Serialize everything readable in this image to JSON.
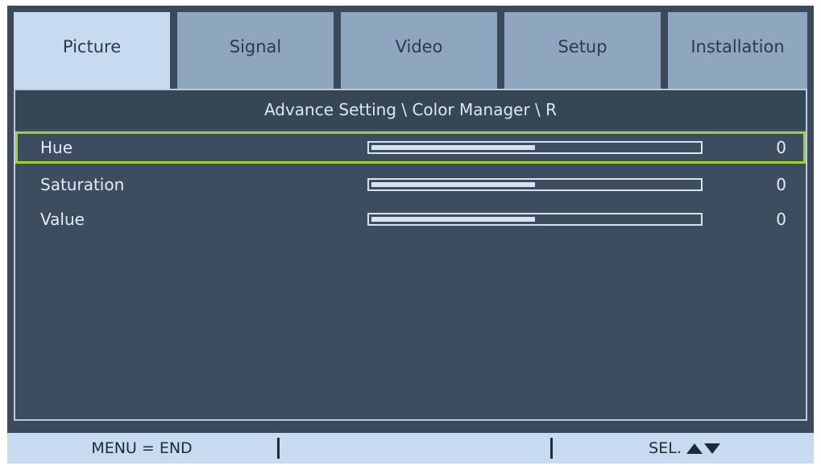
{
  "tabs": [
    {
      "label": "Picture",
      "active": true
    },
    {
      "label": "Signal",
      "active": false
    },
    {
      "label": "Video",
      "active": false
    },
    {
      "label": "Setup",
      "active": false
    },
    {
      "label": "Installation",
      "active": false
    }
  ],
  "breadcrumb": "Advance Setting \\ Color Manager \\ R",
  "rows": [
    {
      "label": "Hue",
      "value": "0",
      "level": 0.5,
      "selected": true
    },
    {
      "label": "Saturation",
      "value": "0",
      "level": 0.5,
      "selected": false
    },
    {
      "label": "Value",
      "value": "0",
      "level": 0.5,
      "selected": false
    }
  ],
  "footer": {
    "menu_label": "MENU = END",
    "select_label": "SEL.",
    "up_icon": "triangle-up-icon",
    "down_icon": "triangle-down-icon"
  },
  "colors": {
    "background": "#3a4a5c",
    "active_tab": "#c6dbef",
    "inactive_tab": "#8fa6bf",
    "highlight": "#9fd42a",
    "text": "#e3ecf5"
  }
}
